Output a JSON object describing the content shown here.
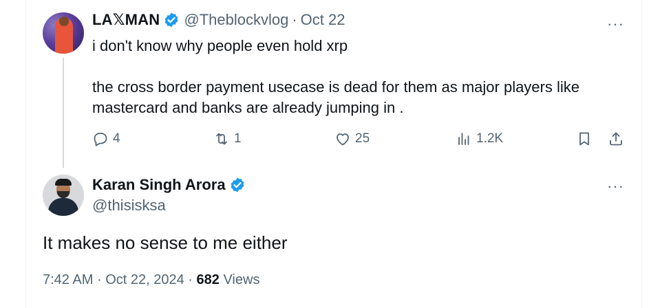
{
  "parent_tweet": {
    "display_name": "LA𝕏MAN",
    "handle": "@Theblockvlog",
    "separator": "·",
    "date": "Oct 22",
    "text": "i don't know why people even hold xrp\n\nthe cross border payment usecase is dead for them as major players like\nmastercard and banks are already jumping in .",
    "actions": {
      "replies": "4",
      "reposts": "1",
      "likes": "25",
      "views": "1.2K"
    },
    "more_label": "···"
  },
  "main_tweet": {
    "display_name": "Karan Singh Arora",
    "handle": "@thisisksa",
    "text": "It makes no sense to me either",
    "time": "7:42 AM",
    "separator": "·",
    "date": "Oct 22, 2024",
    "views_count": "682",
    "views_label": "Views",
    "more_label": "···"
  },
  "colors": {
    "verified": "#1d9bf0",
    "secondary_text": "#536471",
    "primary_text": "#0f1419",
    "thread_line": "#cfd9de"
  },
  "icons": [
    "reply-icon",
    "repost-icon",
    "like-icon",
    "views-icon",
    "bookmark-icon",
    "share-icon",
    "verified-badge-icon",
    "more-icon"
  ]
}
